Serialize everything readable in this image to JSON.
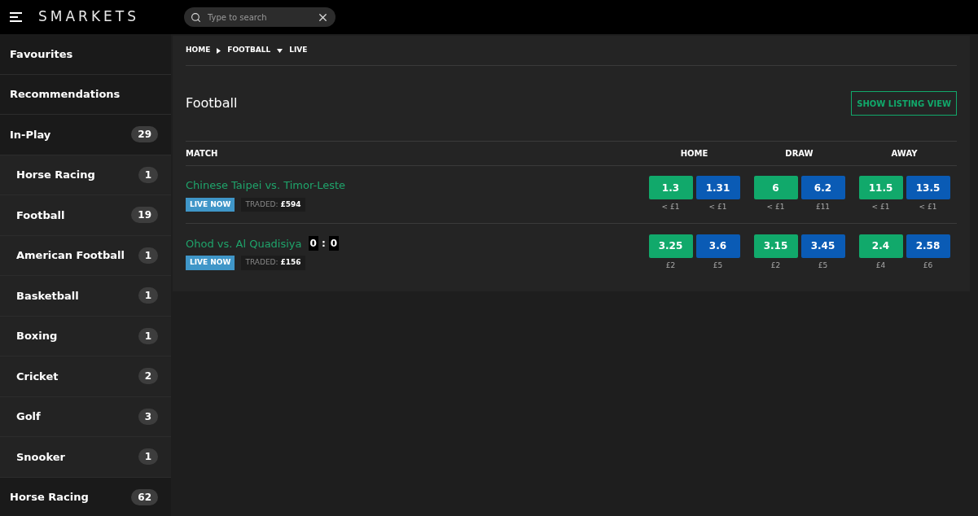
{
  "header": {
    "logo": "SMARKETS",
    "search": {
      "placeholder": "Type to search"
    }
  },
  "sidebar": {
    "items": [
      {
        "label": "Favourites"
      },
      {
        "label": "Recommendations"
      },
      {
        "label": "In-Play",
        "count": "29",
        "children": [
          {
            "label": "Horse Racing",
            "count": "1"
          },
          {
            "label": "Football",
            "count": "19"
          },
          {
            "label": "American Football",
            "count": "1"
          },
          {
            "label": "Basketball",
            "count": "1"
          },
          {
            "label": "Boxing",
            "count": "1"
          },
          {
            "label": "Cricket",
            "count": "2"
          },
          {
            "label": "Golf",
            "count": "3"
          },
          {
            "label": "Snooker",
            "count": "1"
          }
        ]
      },
      {
        "label": "Horse Racing",
        "count": "62"
      }
    ]
  },
  "breadcrumb": [
    "HOME",
    "FOOTBALL",
    "LIVE"
  ],
  "page": {
    "title": "Football",
    "listing_button": "SHOW LISTING VIEW"
  },
  "table": {
    "columns": [
      "MATCH",
      "HOME",
      "DRAW",
      "AWAY"
    ],
    "rows": [
      {
        "match": "Chinese Taipei vs. Timor-Leste",
        "live": "LIVE NOW",
        "traded_label": "TRADED:",
        "traded": "£594",
        "odds": [
          [
            {
              "kind": "back",
              "price": "1.3",
              "amount": "< £1"
            },
            {
              "kind": "lay",
              "price": "1.31",
              "amount": "< £1"
            }
          ],
          [
            {
              "kind": "back",
              "price": "6",
              "amount": "< £1"
            },
            {
              "kind": "lay",
              "price": "6.2",
              "amount": "£11"
            }
          ],
          [
            {
              "kind": "back",
              "price": "11.5",
              "amount": "< £1"
            },
            {
              "kind": "lay",
              "price": "13.5",
              "amount": "< £1"
            }
          ]
        ]
      },
      {
        "match": "Ohod vs. Al Quadisiya",
        "score": [
          "0",
          ":",
          "0"
        ],
        "live": "LIVE NOW",
        "traded_label": "TRADED:",
        "traded": "£156",
        "odds": [
          [
            {
              "kind": "back",
              "price": "3.25",
              "amount": "£2"
            },
            {
              "kind": "lay",
              "price": "3.6",
              "amount": "£5"
            }
          ],
          [
            {
              "kind": "back",
              "price": "3.15",
              "amount": "£2"
            },
            {
              "kind": "lay",
              "price": "3.45",
              "amount": "£5"
            }
          ],
          [
            {
              "kind": "back",
              "price": "2.4",
              "amount": "£4"
            },
            {
              "kind": "lay",
              "price": "2.58",
              "amount": "£6"
            }
          ]
        ]
      }
    ]
  }
}
